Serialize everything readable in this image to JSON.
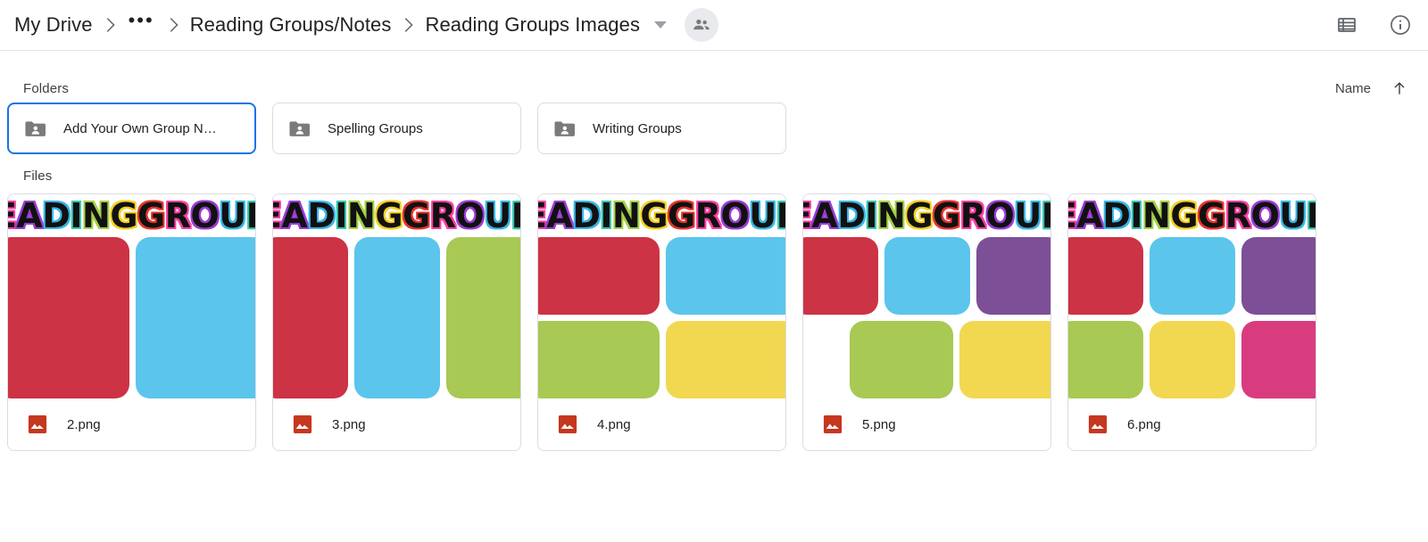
{
  "topbar": {
    "breadcrumb": [
      {
        "label": "My Drive",
        "type": "crumb"
      },
      {
        "label": "•••",
        "type": "ellipsis"
      },
      {
        "label": "Reading Groups/Notes",
        "type": "crumb"
      },
      {
        "label": "Reading Groups Images",
        "type": "crumb"
      }
    ],
    "dropdown_icon": "chevron-down-icon",
    "shared_icon": "people-icon",
    "actions": [
      {
        "name": "list-view-button",
        "icon": "list-view-icon"
      },
      {
        "name": "details-button",
        "icon": "info-icon"
      }
    ]
  },
  "folders_section": {
    "title": "Folders",
    "sort_label": "Name",
    "sort_direction_icon": "arrow-up-icon",
    "items": [
      {
        "name": "Add Your Own Group N…",
        "selected": true,
        "icon": "shared-folder-icon"
      },
      {
        "name": "Spelling Groups",
        "selected": false,
        "icon": "shared-folder-icon"
      },
      {
        "name": "Writing Groups",
        "selected": false,
        "icon": "shared-folder-icon"
      }
    ]
  },
  "files_section": {
    "title": "Files",
    "items": [
      {
        "name": "2.png",
        "type_icon": "image-file-icon",
        "thumbnail": {
          "title": "EADING GROUP",
          "rows": [
            {
              "offset": false,
              "colors": [
                "#cc3344",
                "#5bc5ec"
              ]
            }
          ]
        }
      },
      {
        "name": "3.png",
        "type_icon": "image-file-icon",
        "thumbnail": {
          "title": "EADING GROUP",
          "rows": [
            {
              "offset": false,
              "colors": [
                "#cc3344",
                "#5bc5ec",
                "#a8c954"
              ]
            }
          ]
        }
      },
      {
        "name": "4.png",
        "type_icon": "image-file-icon",
        "thumbnail": {
          "title": "EADING GROUP",
          "rows": [
            {
              "offset": false,
              "colors": [
                "#cc3344",
                "#5bc5ec"
              ]
            },
            {
              "offset": false,
              "colors": [
                "#a8c954",
                "#f2d751"
              ]
            }
          ]
        }
      },
      {
        "name": "5.png",
        "type_icon": "image-file-icon",
        "thumbnail": {
          "title": "EADING GROUP",
          "rows": [
            {
              "offset": false,
              "colors": [
                "#cc3344",
                "#5bc5ec",
                "#7d4f96"
              ]
            },
            {
              "offset": true,
              "colors": [
                "#a8c954",
                "#f2d751"
              ]
            }
          ]
        }
      },
      {
        "name": "6.png",
        "type_icon": "image-file-icon",
        "thumbnail": {
          "title": "EADING GROUP",
          "rows": [
            {
              "offset": false,
              "colors": [
                "#cc3344",
                "#5bc5ec",
                "#7d4f96"
              ]
            },
            {
              "offset": false,
              "colors": [
                "#a8c954",
                "#f2d751",
                "#d93b7f"
              ]
            }
          ]
        }
      }
    ]
  },
  "theme": {
    "accent": "#1a73e8",
    "text": "#202124",
    "muted": "#5f6368",
    "border": "#dadce0",
    "file_icon_red": "#c5371f",
    "title_outline_colors": [
      "#ff3ea5",
      "#9b3bd4",
      "#35b6e8",
      "#35c6b0",
      "#a3d042",
      "#f5d020",
      "#f58220",
      "#e8322b",
      "#ff3ea5",
      "#9b3bd4",
      "#35b6e8",
      "#35c6b0",
      "#a3d042"
    ]
  }
}
